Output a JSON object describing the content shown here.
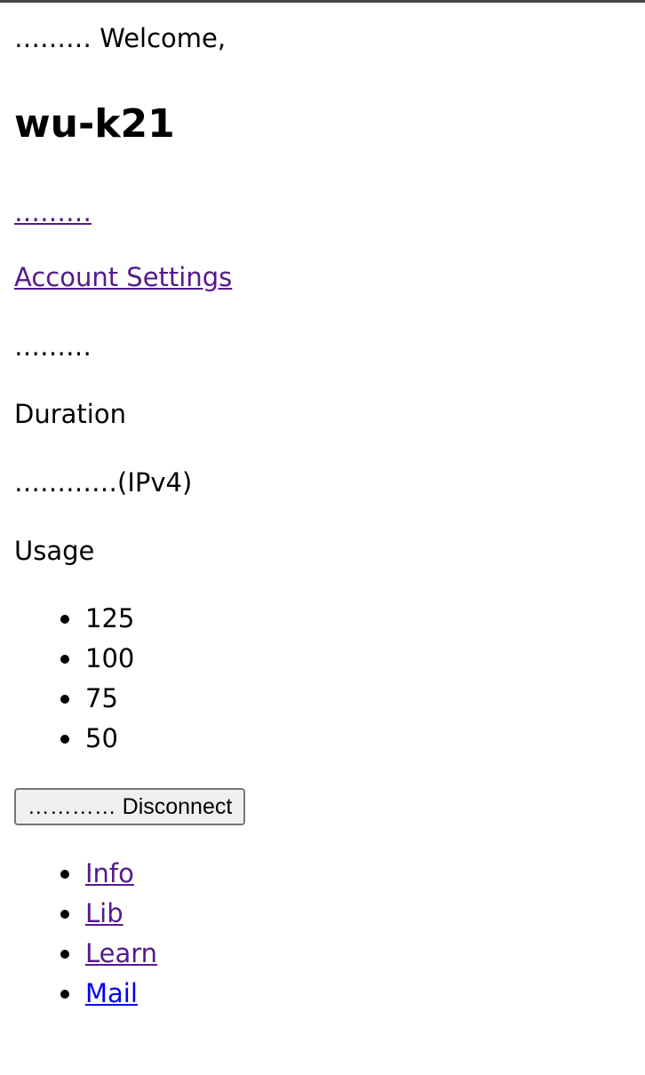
{
  "header": {
    "welcome_text": "……… Welcome,",
    "username": "wu-k21"
  },
  "links": {
    "dots_link": "………",
    "account_settings": "Account Settings"
  },
  "info": {
    "dots_label": "………",
    "duration_label": "Duration",
    "ip_label": "…………(IPv4)",
    "usage_label": "Usage"
  },
  "usage_options": [
    "125",
    "100",
    "75",
    "50"
  ],
  "actions": {
    "disconnect_label": "………… Disconnect"
  },
  "nav": {
    "items": [
      "Info",
      "Lib",
      "Learn",
      "Mail"
    ]
  }
}
